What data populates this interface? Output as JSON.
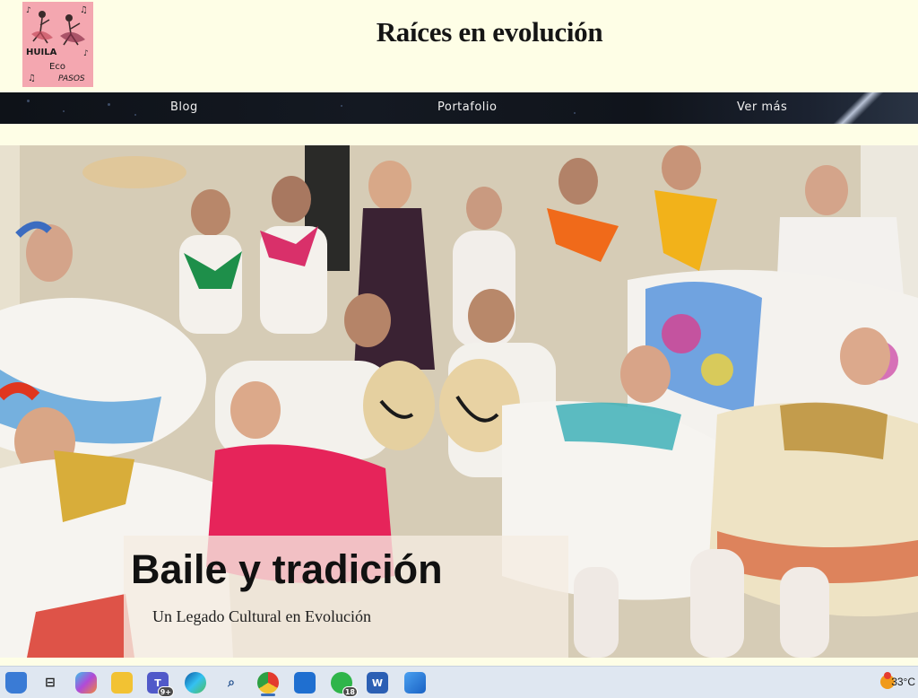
{
  "header": {
    "logo_words": [
      "HUILA",
      "Eco",
      "PASOS"
    ],
    "title": "Raíces en evolución"
  },
  "nav": {
    "items": [
      {
        "label": "Blog"
      },
      {
        "label": "Portafolio"
      },
      {
        "label": "Ver más"
      }
    ]
  },
  "hero": {
    "title": "Baile y tradición",
    "subtitle": "Un Legado Cultural en Evolución"
  },
  "taskbar": {
    "apps": [
      {
        "icon": "file-explorer-icon",
        "badge": ""
      },
      {
        "icon": "task-view-icon",
        "badge": ""
      },
      {
        "icon": "copilot-icon",
        "badge": ""
      },
      {
        "icon": "folder-icon",
        "badge": ""
      },
      {
        "icon": "teams-icon",
        "badge": "9+"
      },
      {
        "icon": "edge-icon",
        "badge": ""
      },
      {
        "icon": "search-icon",
        "badge": ""
      },
      {
        "icon": "chrome-icon",
        "badge": ""
      },
      {
        "icon": "store-icon",
        "badge": ""
      },
      {
        "icon": "whatsapp-icon",
        "badge": "18"
      },
      {
        "icon": "word-icon",
        "badge": ""
      },
      {
        "icon": "photos-icon",
        "badge": ""
      }
    ],
    "weather": {
      "temp": "33°C",
      "icon": "sun-icon"
    }
  },
  "colors": {
    "page_bg": "#fefee6",
    "nav_bg": "#10141b",
    "logo_bg": "#f4a7b0"
  }
}
